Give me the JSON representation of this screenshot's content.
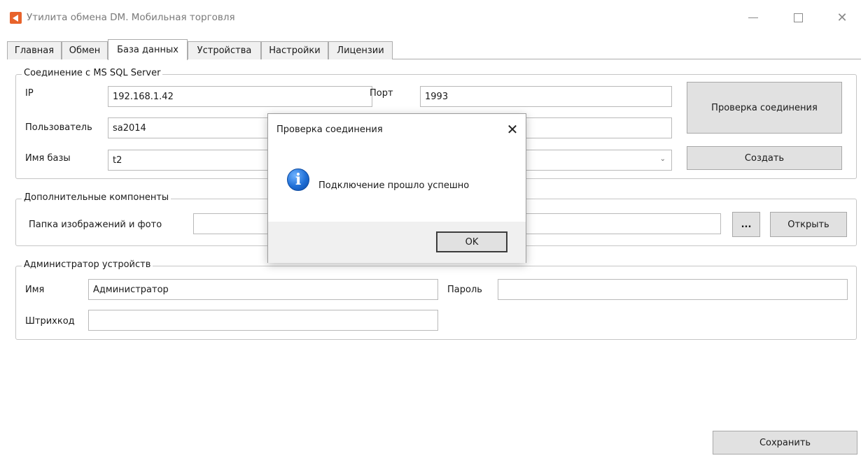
{
  "window": {
    "title": "Утилита обмена DM. Мобильная торговля"
  },
  "tabs": [
    {
      "label": "Главная"
    },
    {
      "label": "Обмен"
    },
    {
      "label": "База данных"
    },
    {
      "label": "Устройства"
    },
    {
      "label": "Настройки"
    },
    {
      "label": "Лицензии"
    }
  ],
  "active_tab": "База данных",
  "sql_group": {
    "legend": "Соединение с MS SQL Server",
    "ip_label": "IP",
    "ip_value": "192.168.1.42",
    "port_label": "Порт",
    "port_value": "1993",
    "user_label": "Пользователь",
    "user_value": "sa2014",
    "password_value": "",
    "db_label": "Имя базы",
    "db_value": "t2",
    "check_button": "Проверка соединения",
    "create_button": "Создать"
  },
  "extra_group": {
    "legend": "Дополнительные компоненты",
    "folder_label": "Папка изображений и фото",
    "folder_value": "",
    "browse_button": "...",
    "open_button": "Открыть"
  },
  "admin_group": {
    "legend": "Администратор устройств",
    "name_label": "Имя",
    "name_value": "Администратор",
    "password_label": "Пароль",
    "password_value": "",
    "barcode_label": "Штрихкод",
    "barcode_value": ""
  },
  "save_button": "Сохранить",
  "dialog": {
    "title": "Проверка соединения",
    "message": "Подключение прошло успешно",
    "ok_button": "OK",
    "icon": "info-icon"
  },
  "colors": {
    "app_icon": "#e8632b",
    "info_icon": "#1f6fd6",
    "button_face": "#e1e1e1"
  }
}
